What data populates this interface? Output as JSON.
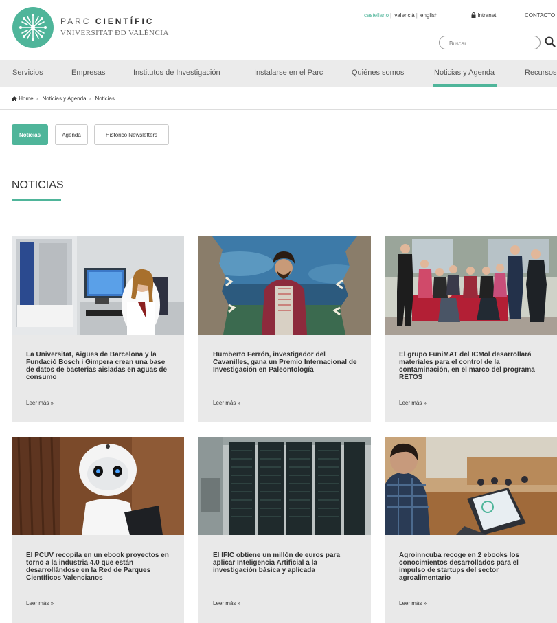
{
  "header": {
    "brand_line1_light": "PARC ",
    "brand_line1_bold": "CIENTÍFIC",
    "brand_line2": "VNIVERSITAT ĐD VALÈNCIA",
    "languages": [
      "castellano",
      "valencià",
      "english"
    ],
    "active_language": "castellano",
    "intranet": "Intranet",
    "contacto": "CONTACTO",
    "search_placeholder": "Buscar...",
    "brand_color": "#4fb59a"
  },
  "nav": {
    "items": [
      "Servicios",
      "Empresas",
      "Institutos de Investigación",
      "Instalarse en el Parc",
      "Quiénes somos",
      "Noticias y Agenda",
      "Recursos"
    ],
    "active": "Noticias y Agenda"
  },
  "breadcrumb": [
    "Home",
    "Noticias y Agenda",
    "Noticias"
  ],
  "tabs": [
    "Noticias",
    "Agenda",
    "Histórico Newsletters"
  ],
  "active_tab": "Noticias",
  "page_title": "NOTICIAS",
  "read_more": "Leer más »",
  "cards": [
    {
      "title": "La Universitat, Aigües de Barcelona y la Fundació Bosch i Gimpera crean una base de datos de bacterias aisladas en aguas de consumo",
      "image": "lab-researcher-computer"
    },
    {
      "title": "Humberto Ferrón, investigador del Cavanilles, gana un Premio Internacional de Investigación en Paleontología",
      "image": "researcher-shark-jaws"
    },
    {
      "title": "El grupo FuniMAT del ICMol desarrollará materiales para el control de la contaminación, en el marco del programa RETOS",
      "image": "group-photo"
    },
    {
      "title": "El PCUV recopila en un ebook proyectos en torno a la industria 4.0 que están desarrollándose en la Red de Parques Científicos Valencianos",
      "image": "humanoid-robot"
    },
    {
      "title": "El IFIC obtiene un millón de euros para aplicar Inteligencia Artificial a la investigación básica y aplicada",
      "image": "server-racks"
    },
    {
      "title": "Agroinncuba recoge en 2 ebooks los conocimientos desarrollados para el impulso de startups del sector agroalimentario",
      "image": "meeting-room-laptop"
    }
  ]
}
